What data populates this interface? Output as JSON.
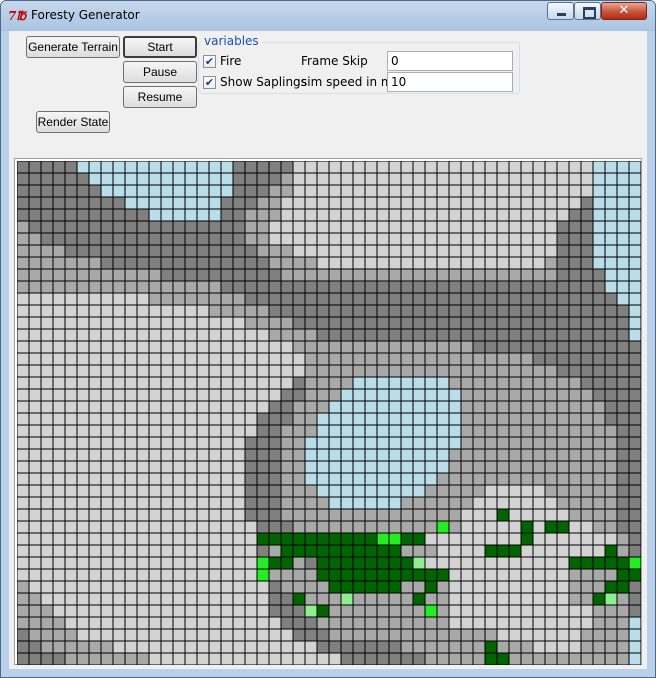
{
  "window": {
    "title": "Foresty Generator",
    "icon": "tk-feather-icon",
    "icon_glyph": "7℔",
    "controls": {
      "minimize": "minimize-icon",
      "maximize": "maximize-icon",
      "close": "close-icon",
      "close_glyph": "✕"
    }
  },
  "buttons": {
    "generate_terrain": "Generate Terrain",
    "start": "Start",
    "pause": "Pause",
    "resume": "Resume",
    "render_state": "Render State"
  },
  "variables": {
    "legend": "variables",
    "fire": {
      "label": "Fire",
      "checked": true
    },
    "show_saplings": {
      "label": "Show Saplings",
      "checked": true
    },
    "frame_skip": {
      "label": "Frame Skip",
      "value": "0"
    },
    "sim_speed": {
      "label": "sim speed in ms",
      "value": "10"
    }
  },
  "grid": {
    "columns": 52,
    "rows": 42,
    "palette": {
      "W": "#b9dde9",
      "L": "#d3d3d3",
      "M": "#a9a9a9",
      "D": "#808080",
      "T": "#006400",
      "S": "#22ee22",
      "P": "#90ee90"
    },
    "line_color": "#000000",
    "cells": [
      "DDDDDWWWWWWWWWWWWWDDDDDLLLLLLLLLLLLLLLLLLLLLLLLLWWWW",
      "DDDDDDWWWWWWWWWWWWDDDDMLLLLLLLLLLLLLLLLLLLLLLLLLWWWW",
      "DDDDDDDWWWWWWWWWWWDDDMMLLLLLLLLLLLLLLLLLLLLLLLLLWWWW",
      "DDDDDDDDDWWWWWWWWDDDMMLLLLLLLLLLLLLLLLLLLLLLLLLDWWWW",
      "DDDDDDDDDDDWWWWWWDDMMMLLLLLLLLLLLLLLLLLLLLLLLLDDWWWW",
      "MDDDDDDDDDDDDDDDDDDMMLLLLLLLLLLLLLLLLLLLLLLLLDDDWWWW",
      "MMDDDDDDDDDDDDDDDDDMMLLLLLLLLLLLLLLLLLLLLLLLLDDDWWWW",
      "MMMMDDDDDDDDDDDDDDDDMMMLLLLLLLLLLLLLLLLLLLLLLDDDWWWW",
      "MMMMMMMDDDDDDDDDDDDDDMMMMLLLLLLLLLLLLLLLLLLLMDDDWWWW",
      "MMMMMMMMMMMMDDDDDDDDDDMMMMMMMMMMMMMMMMMMMMMMMDDDDWWW",
      "MMMMMMMMMMMMMMMMMDDDDDDDDDDDDDDDDDDDDDDDDDDDDDDDDWWW",
      "LLLLLLLLLLLMMMMMMMMDDDDDDDDDDDDDDDDDDDDDDDDDDDDDDDWW",
      "LLLLLLLLLLLLLLLLMMMMMDDDDDDDDDDDDDDDDDDDDDDDDDDDDDDW",
      "LLLLLLLLLLLLLLLLLLLMMMMDDDDDDDDDDDDDDDDDDDDDDDDDDDDW",
      "LLLLLLLLLLLLLLLLLLLLLMMMMDDDDDDDDDDDDDDDDDDDDDDDDDDW",
      "LLLLLLLLLLLLLLLLLLLLLLLMMMMMMMMMMMMMMMDDDDDDDDDDDDDD",
      "LLLLLLLLLLLLLLLLLLLLLLLLMMMMMMMMMMMMMMMMMMMDDDDDDDDD",
      "LLLLLLLLLLLLLLLLLLLLLLLLMMMMMMMMMMMMMMMMMMMMMDDDDDDD",
      "LLLLLLLLLLLLLLLLLLLLLLLDMMMMWWWWWWWWMMMMMMMMMMMDDDDD",
      "LLLLLLLLLLLLLLLLLLLLLLDDMMMWWWWWWWWWWMMMMMMMMMMMDDDD",
      "LLLLLLLLLLLLLLLLLLLLLDDMMMWWWWWWWWWWWMMMMMMMMMMMMDDD",
      "LLLLLLLLLLLLLLLLLLLLDDDMMWWWWWWWWWWWWMMMMMMMMMMMMDDD",
      "LLLLLLLLLLLLLLLLLLLLDDMMMWWWWWWWWWWWWMMMMMMMMMMMMMDD",
      "LLLLLLLLLLLLLLLLLLLDDDMMWWWWWWWWWWWWWMMMMMMMMMMMMMDD",
      "LLLLLLLLLLLLLLLLLLLDDDMMWWWWWWWWWWWWMMMMMMMMMMMMMMDD",
      "LLLLLLLLLLLLLLLLLLLDDDMMWWWWWWWWWWWWMMMMMMMMMMMMMMDD",
      "LLLLLLLLLLLLLLLLLLLDDDMMWWWWWWWWWWWMMMMMMMMMMMMMMMDD",
      "LLLLLLLLLLLLLLLLLLLDDDMMMWWWWWWWWWMMMMMLLLLLMMMMMMDD",
      "LLLLLLLLLLLLLLLLLLLDDDMMMMWWWWWWMMMMMMLLLLLLLMMMMMDD",
      "LLLLLLLLLLLLLLLLLLLDDDMMMMMMMMMMMMMMMLLLTLLLLLMMMMDD",
      "LLLLLLLLLLLLLLLLLLLLDDDMMMMMMMMMMMMSMLLLLLTLTTLLMMDD",
      "LLLLLLLLLLLLLLLLLLLLTTTTTTTTTTSSTTLLLLLLLLTLLLLLLLMD",
      "LLLLLLLLLLLLLLLLLLLLDMTTTTTTTTTTMMMLLLLTTTLLLLLLLTMD",
      "LLLLLLLLLLLLLLLLLLLLSTTMDTTTTTTTTPLLLLLLLLLLLLTTTTTS",
      "LLLLLLLLLLLLLLLLLLLLSMMMMTTTTTTTTTTTLLLLLLLLLLMMMMTT",
      "MLLLLLLLLLLLLLLLLLLLLDMMMMTTTTTTMMTMLLLLLLLLLLMMMTTD",
      "MMLLLLLLLLLLLLLLLLLLLDDTMMMPMMMMMTMMLLLLLLLLLLMMTPMD",
      "MMMLLLLLLLLLLLLLLLLLLDDDPTMMMMMMMMSMLLLLLLLLLLLLMMMD",
      "MMMMLLLLLLLLLLLLLLLLLLDDDMMMMMMMMMMMLLLLLLLLLLLLMMMW",
      "DMMMMLLLLLLLLLLLLLLLLLLDDDMMMMMMMMMMMMMMLLLLLLLMMMMW",
      "DDMMMMMMLLLLLLLLLLLLLLLLLDDDDDDDMMMMMMMTMMMLLLLMMMMW",
      "DDDDMMMMMMMLLLLLLLLLLLLLLLLDDDDDDDMMMMMTTMMMMMMMMMMW"
    ]
  }
}
